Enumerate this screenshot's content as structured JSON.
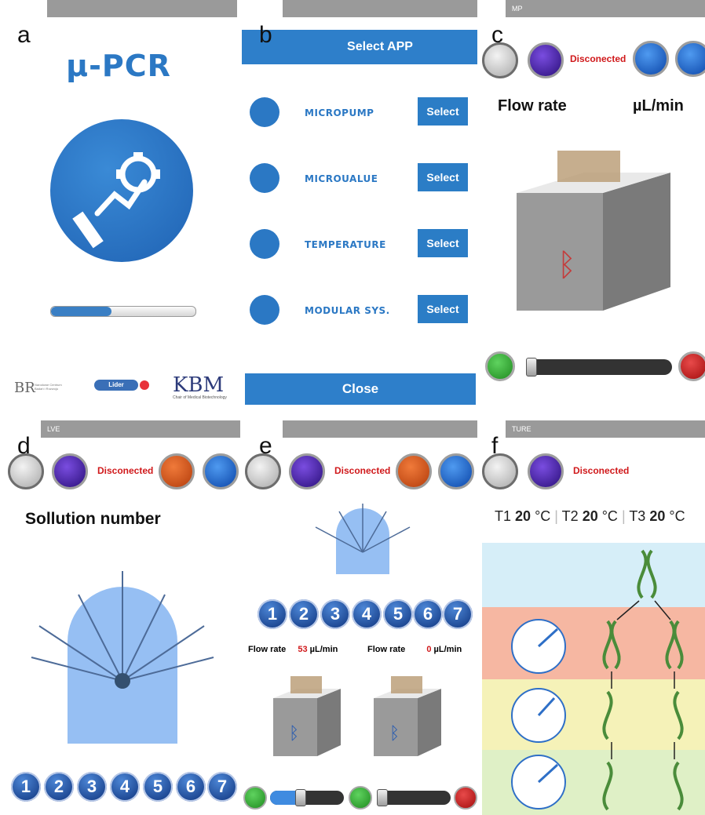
{
  "labels": {
    "a": "a",
    "b": "b",
    "c": "c",
    "d": "d",
    "e": "e",
    "f": "f"
  },
  "panel_a": {
    "logo": "µ-PCR",
    "progress": 0.42,
    "sponsors": [
      "Lider",
      "KBM"
    ],
    "kbm_caption": "Chair of Medical Biotechnology",
    "br_caption": "Narodowe Centrum Badań i Rozwoju"
  },
  "panel_b": {
    "header": "Select APP",
    "apps": [
      {
        "name": "MICROPUMP",
        "button": "Select"
      },
      {
        "name": "MICROUALUE",
        "button": "Select"
      },
      {
        "name": "TEMPERATURE",
        "button": "Select"
      },
      {
        "name": "MODULAR SYS.",
        "button": "Select"
      }
    ],
    "close": "Close"
  },
  "panel_c": {
    "bar_title": "MP",
    "status": "Disconected",
    "flow_label": "Flow rate",
    "unit": "µL/min",
    "slider": 0.0
  },
  "panel_d": {
    "bar_title": "LVE",
    "status": "Disconected",
    "title": "Sollution number",
    "numbers": [
      "1",
      "2",
      "3",
      "4",
      "5",
      "6",
      "7"
    ]
  },
  "panel_e": {
    "status": "Disconected",
    "numbers": [
      "1",
      "2",
      "3",
      "4",
      "5",
      "6",
      "7"
    ],
    "flow1_label": "Flow rate",
    "flow1_value": "53",
    "flow2_label": "Flow rate",
    "flow2_value": "0",
    "unit": "µL/min",
    "slider1": 0.4,
    "slider2": 0.0
  },
  "panel_f": {
    "bar_title": "TURE",
    "status": "Disconected",
    "temps": [
      {
        "label": "T1",
        "value": "20",
        "unit": "°C"
      },
      {
        "label": "T2",
        "value": "20",
        "unit": "°C"
      },
      {
        "label": "T3",
        "value": "20",
        "unit": "°C"
      }
    ],
    "zones": [
      "#d6eef8",
      "#f6b7a2",
      "#f5f2b8",
      "#dff0c6"
    ]
  },
  "colors": {
    "accent": "#2b78c4",
    "status_red": "#d0191b",
    "play_green": "#2fa52f",
    "stop_red": "#c81414"
  }
}
